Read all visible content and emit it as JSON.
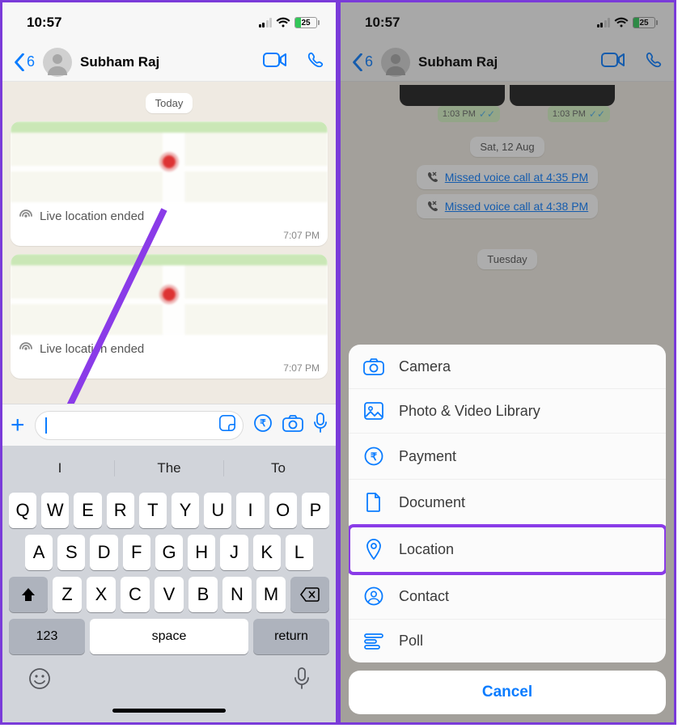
{
  "left": {
    "status": {
      "time": "10:57",
      "battery": "25"
    },
    "header": {
      "back_count": "6",
      "name": "Subham Raj"
    },
    "chat": {
      "day_label": "Today",
      "loc1": {
        "caption": "Live location ended",
        "time": "7:07 PM"
      },
      "loc2": {
        "caption": "Live location ended",
        "time": "7:07 PM"
      }
    },
    "keyboard": {
      "pred": [
        "I",
        "The",
        "To"
      ],
      "row1": [
        "Q",
        "W",
        "E",
        "R",
        "T",
        "Y",
        "U",
        "I",
        "O",
        "P"
      ],
      "row2": [
        "A",
        "S",
        "D",
        "F",
        "G",
        "H",
        "J",
        "K",
        "L"
      ],
      "row3": [
        "Z",
        "X",
        "C",
        "V",
        "B",
        "N",
        "M"
      ],
      "num": "123",
      "space": "space",
      "return": "return"
    }
  },
  "right": {
    "status": {
      "time": "10:57",
      "battery": "25"
    },
    "header": {
      "back_count": "6",
      "name": "Subham Raj"
    },
    "chat": {
      "thumb_time": "1:03 PM",
      "day1": "Sat, 12 Aug",
      "missed1": "Missed voice call at 4:35 PM",
      "missed2": "Missed voice call at 4:38 PM",
      "day2": "Tuesday"
    },
    "sheet": {
      "items": [
        {
          "label": "Camera"
        },
        {
          "label": "Photo & Video Library"
        },
        {
          "label": "Payment"
        },
        {
          "label": "Document"
        },
        {
          "label": "Location"
        },
        {
          "label": "Contact"
        },
        {
          "label": "Poll"
        }
      ],
      "cancel": "Cancel"
    }
  }
}
